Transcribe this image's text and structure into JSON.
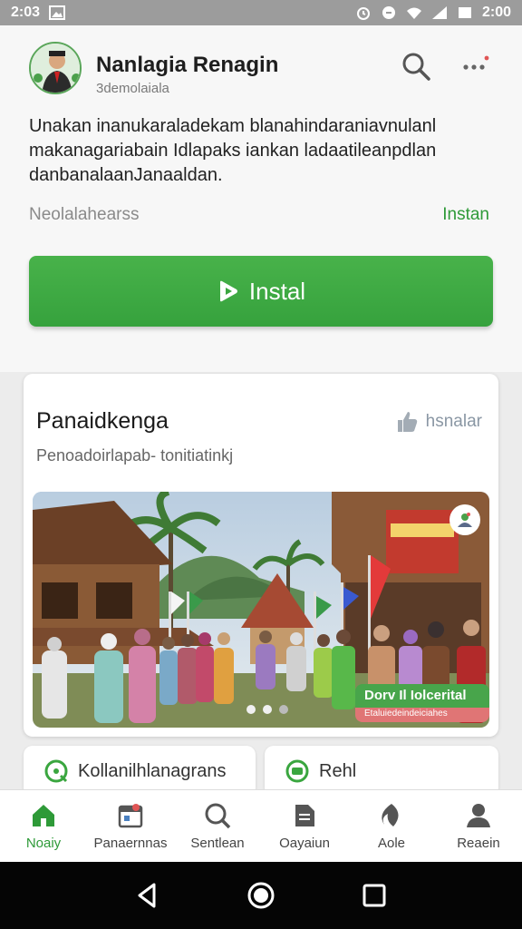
{
  "status_bar": {
    "time_left": "2:03",
    "time_right": "2:00"
  },
  "app": {
    "name": "Nanlagia Renagin",
    "subtitle": "3demolaiala",
    "description": "Unakan inanukaraladekam blanahindaraniavnulanl makanagariabain Idlapaks iankan ladaatileanpdlan danbanalaanJanaaldan.",
    "meta_left": "Neolalahearss",
    "meta_right": "Instan",
    "install_label": "Instal"
  },
  "feature_card": {
    "title": "Panaidkenga",
    "action_label": "hsnalar",
    "subtitle": "Penoadoirlapab- tonitiatinkj",
    "badge_title": "Dorv Il Iolcerital",
    "badge_sub": "Etaluiedeindeiciahes"
  },
  "chips": [
    {
      "label": "Kollanilhlanagrans",
      "icon": "chat-search-icon"
    },
    {
      "label": "Rehl",
      "icon": "chat-icon"
    }
  ],
  "bottom_nav": [
    {
      "label": "Noaiy",
      "icon": "home-icon",
      "active": true
    },
    {
      "label": "Panaernnas",
      "icon": "calendar-icon",
      "active": false
    },
    {
      "label": "Sentlean",
      "icon": "search-icon",
      "active": false
    },
    {
      "label": "Oayaiun",
      "icon": "document-icon",
      "active": false
    },
    {
      "label": "Aole",
      "icon": "leaf-icon",
      "active": false
    },
    {
      "label": "Reaein",
      "icon": "person-icon",
      "active": false
    }
  ],
  "colors": {
    "accent": "#3aa63f",
    "background": "#ececec",
    "status_bar": "#9c9c9c"
  }
}
